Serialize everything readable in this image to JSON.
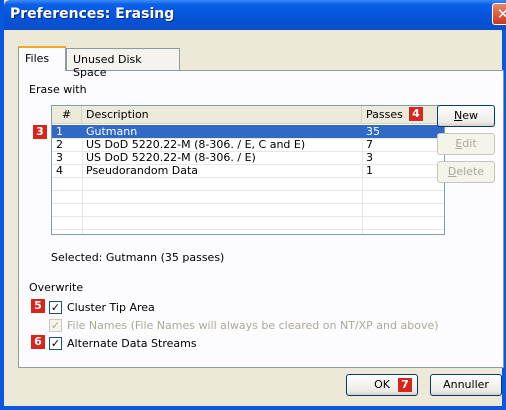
{
  "window": {
    "title": "Preferences: Erasing",
    "close_symbol": "✕"
  },
  "tabs": [
    {
      "label": "Files",
      "active": true
    },
    {
      "label": "Unused Disk Space",
      "active": false
    }
  ],
  "erase_with": {
    "label": "Erase with",
    "columns": [
      "#",
      "Description",
      "Passes"
    ],
    "rows": [
      {
        "num": "1",
        "description": "Gutmann",
        "passes": "35",
        "selected": true
      },
      {
        "num": "2",
        "description": "US DoD 5220.22-M (8-306. / E, C and E)",
        "passes": "7",
        "selected": false
      },
      {
        "num": "3",
        "description": "US DoD 5220.22-M (8-306. / E)",
        "passes": "3",
        "selected": false
      },
      {
        "num": "4",
        "description": "Pseudorandom Data",
        "passes": "1",
        "selected": false
      }
    ],
    "selected_text": "Selected: Gutmann (35 passes)"
  },
  "side_buttons": {
    "new": {
      "underline": "N",
      "rest": "ew"
    },
    "edit": {
      "underline": "E",
      "rest": "dit"
    },
    "delete": {
      "underline": "D",
      "rest": "elete"
    }
  },
  "overwrite": {
    "label": "Overwrite",
    "cluster_tip": {
      "label": "Cluster Tip Area",
      "checked": true
    },
    "file_names": {
      "label": "File Names (File Names will always be cleared on NT/XP and above)",
      "checked": true,
      "disabled": true
    },
    "alternate_streams": {
      "label": "Alternate Data Streams",
      "checked": true
    }
  },
  "footer": {
    "ok": "OK",
    "cancel": "Annuller"
  },
  "markers": {
    "m3": "3",
    "m4": "4",
    "m5": "5",
    "m6": "6",
    "m7": "7"
  },
  "colors": {
    "title_bar": "#0a5fe8",
    "selection": "#316ac5",
    "marker": "#d9261c"
  },
  "check_symbol": "✓"
}
